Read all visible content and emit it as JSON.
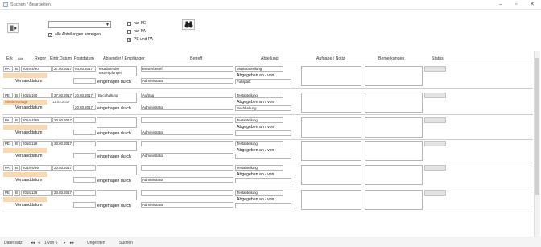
{
  "window": {
    "title": "Suchen / Bearbeiten",
    "minimize": "–",
    "maximize": "▫",
    "close": "✕"
  },
  "toolbar": {
    "exit_icon": "exit-icon",
    "combo_value": "",
    "show_all_label": "alle Abteilungen anzeigen",
    "show_all_checked": "✓",
    "filters": [
      {
        "label": "nur PE",
        "checked": ""
      },
      {
        "label": "nur PA",
        "checked": ""
      },
      {
        "label": "PE und PA",
        "checked": "✓"
      }
    ],
    "search_icon": "binoculars-icon"
  },
  "columns": [
    "Erk",
    "Abb",
    "Regnr",
    "Eintr.Datum",
    "Postdatum",
    "Absender / Empfänger",
    "Betreff",
    "Abteilung",
    "Aufgabe / Notiz",
    "Bemerkungen",
    "Status"
  ],
  "labels": {
    "versand": "Versanddatum",
    "eingetragen": "eingetragen durch",
    "abgegeben": "Abgegeben an / von"
  },
  "records": [
    {
      "erk": "PA",
      "abb": "B",
      "regnr": "2014-4/90",
      "eintr": "27.03.2017",
      "post": "04.03.2017",
      "absender": "Textabsender Textempfänger",
      "betreff": "Musterbetreff",
      "abteilung": "Musterabteilung",
      "eingetragen": "Administrator",
      "abgegeben": "Fuhrpark",
      "versand": "",
      "orange": ""
    },
    {
      "erk": "PE",
      "abb": "B",
      "regnr": "2015/190",
      "eintr": "27.03.2017",
      "post": "20.03.2017",
      "absender": "Buchhaltung",
      "betreff": "Auftrag",
      "abteilung": "Testabteilung",
      "eingetragen": "Administrator",
      "abgegeben": "Buchhaltung",
      "versand": "20.03.2017",
      "orange": "Wiedervorlage",
      "eintr2": "11.03.2017"
    },
    {
      "erk": "PA",
      "abb": "B",
      "regnr": "2014-4/99",
      "eintr": "23.03.2017",
      "post": "",
      "absender": "",
      "betreff": "",
      "abteilung": "Testabteilung",
      "eingetragen": "Administrator",
      "abgegeben": "",
      "versand": "",
      "orange": ""
    },
    {
      "erk": "PE",
      "abb": "B",
      "regnr": "2016/128",
      "eintr": "23.03.2017",
      "post": "",
      "absender": "",
      "betreff": "",
      "abteilung": "Testabteilung",
      "eingetragen": "Administrator",
      "abgegeben": "",
      "versand": "",
      "orange": ""
    },
    {
      "erk": "PA",
      "abb": "B",
      "regnr": "2014-4/99",
      "eintr": "20.03.2017",
      "post": "",
      "absender": "",
      "betreff": "",
      "abteilung": "Testabteilung",
      "eingetragen": "Administrator",
      "abgegeben": "",
      "versand": "",
      "orange": ""
    },
    {
      "erk": "PE",
      "abb": "B",
      "regnr": "2016/128",
      "eintr": "23.03.2017",
      "post": "",
      "absender": "",
      "betreff": "",
      "abteilung": "Testabteilung",
      "eingetragen": "Administrator",
      "abgegeben": "",
      "versand": "",
      "orange": ""
    }
  ],
  "statusbar": {
    "label": "Datensatz:",
    "first": "◂◂",
    "prev": "◂",
    "position": "1 von 6",
    "next": "▸",
    "last": "▸▸",
    "filter": "Ungefiltert",
    "search": "Suchen"
  }
}
